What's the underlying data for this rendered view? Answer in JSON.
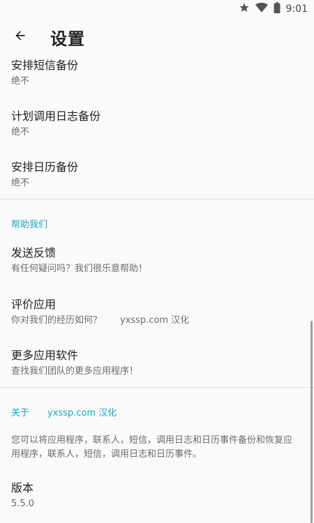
{
  "status_bar": {
    "time": "9:01",
    "icons": [
      "star-icon",
      "wifi-icon",
      "battery-icon"
    ]
  },
  "app_bar": {
    "title": "设置",
    "back_icon": "arrow-left-icon"
  },
  "backup": {
    "sms": {
      "title": "安排短信备份",
      "value": "绝不"
    },
    "calllog": {
      "title": "计划调用日志备份",
      "value": "绝不"
    },
    "calendar": {
      "title": "安排日历备份",
      "value": "绝不"
    }
  },
  "help": {
    "header": "帮助我们",
    "feedback": {
      "title": "发送反馈",
      "subtitle": "有任何疑问吗？我们很乐意帮助！"
    },
    "rate": {
      "title": "评价应用",
      "subtitle": "你对我们的经历如何？",
      "watermark": "yxssp.com 汉化"
    },
    "more": {
      "title": "更多应用软件",
      "subtitle": "查找我们团队的更多应用程序！"
    }
  },
  "about": {
    "header": "关于",
    "watermark": "yxssp.com 汉化",
    "description": "您可以将应用程序，联系人，短信，调用日志和日历事件备份和恢复应用程序，联系人，短信，调用日志和日历事件。",
    "version_title": "版本",
    "version_value": "5.5.0"
  },
  "colors": {
    "accent": "#1aa6c0",
    "background": "#fafafa",
    "divider": "#dedede"
  }
}
